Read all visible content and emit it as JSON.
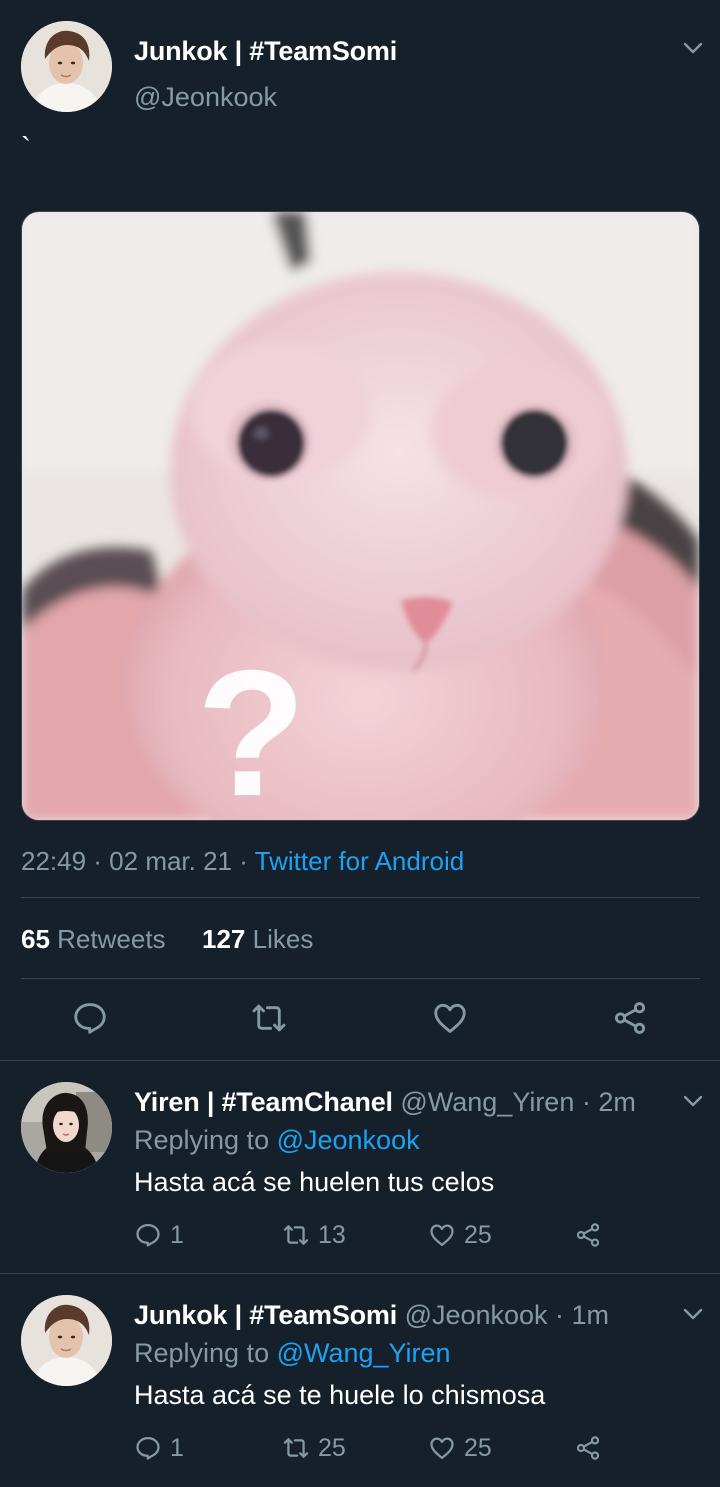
{
  "main_tweet": {
    "author_name": "Junkok | #TeamSomi",
    "author_handle": "@Jeonkook",
    "text": "`",
    "time": "22:49 · 02 mar. 21 · ",
    "source": "Twitter for Android",
    "retweets_count": "65",
    "retweets_label": "Retweets",
    "likes_count": "127",
    "likes_label": "Likes",
    "media_overlay_text": "?",
    "icons": [
      "reply-icon",
      "retweet-icon",
      "like-icon",
      "share-icon",
      "chevron-down-icon"
    ]
  },
  "replies": [
    {
      "author_name": "Yiren | #TeamChanel",
      "author_handle": "@Wang_Yiren · 2m",
      "replying_prefix": "Replying to ",
      "replying_to": "@Jeonkook",
      "text": "Hasta acá se huelen tus celos",
      "reply_count": "1",
      "retweet_count": "13",
      "like_count": "25"
    },
    {
      "author_name": "Junkok | #TeamSomi",
      "author_handle": "@Jeonkook · 1m",
      "replying_prefix": "Replying to ",
      "replying_to": "@Wang_Yiren",
      "text": "Hasta acá se te huele lo chismosa",
      "reply_count": "1",
      "retweet_count": "25",
      "like_count": "25"
    }
  ],
  "colors": {
    "background": "#15202b",
    "divider": "#38444d",
    "secondary_text": "#8899a6",
    "accent": "#1da1f2"
  }
}
